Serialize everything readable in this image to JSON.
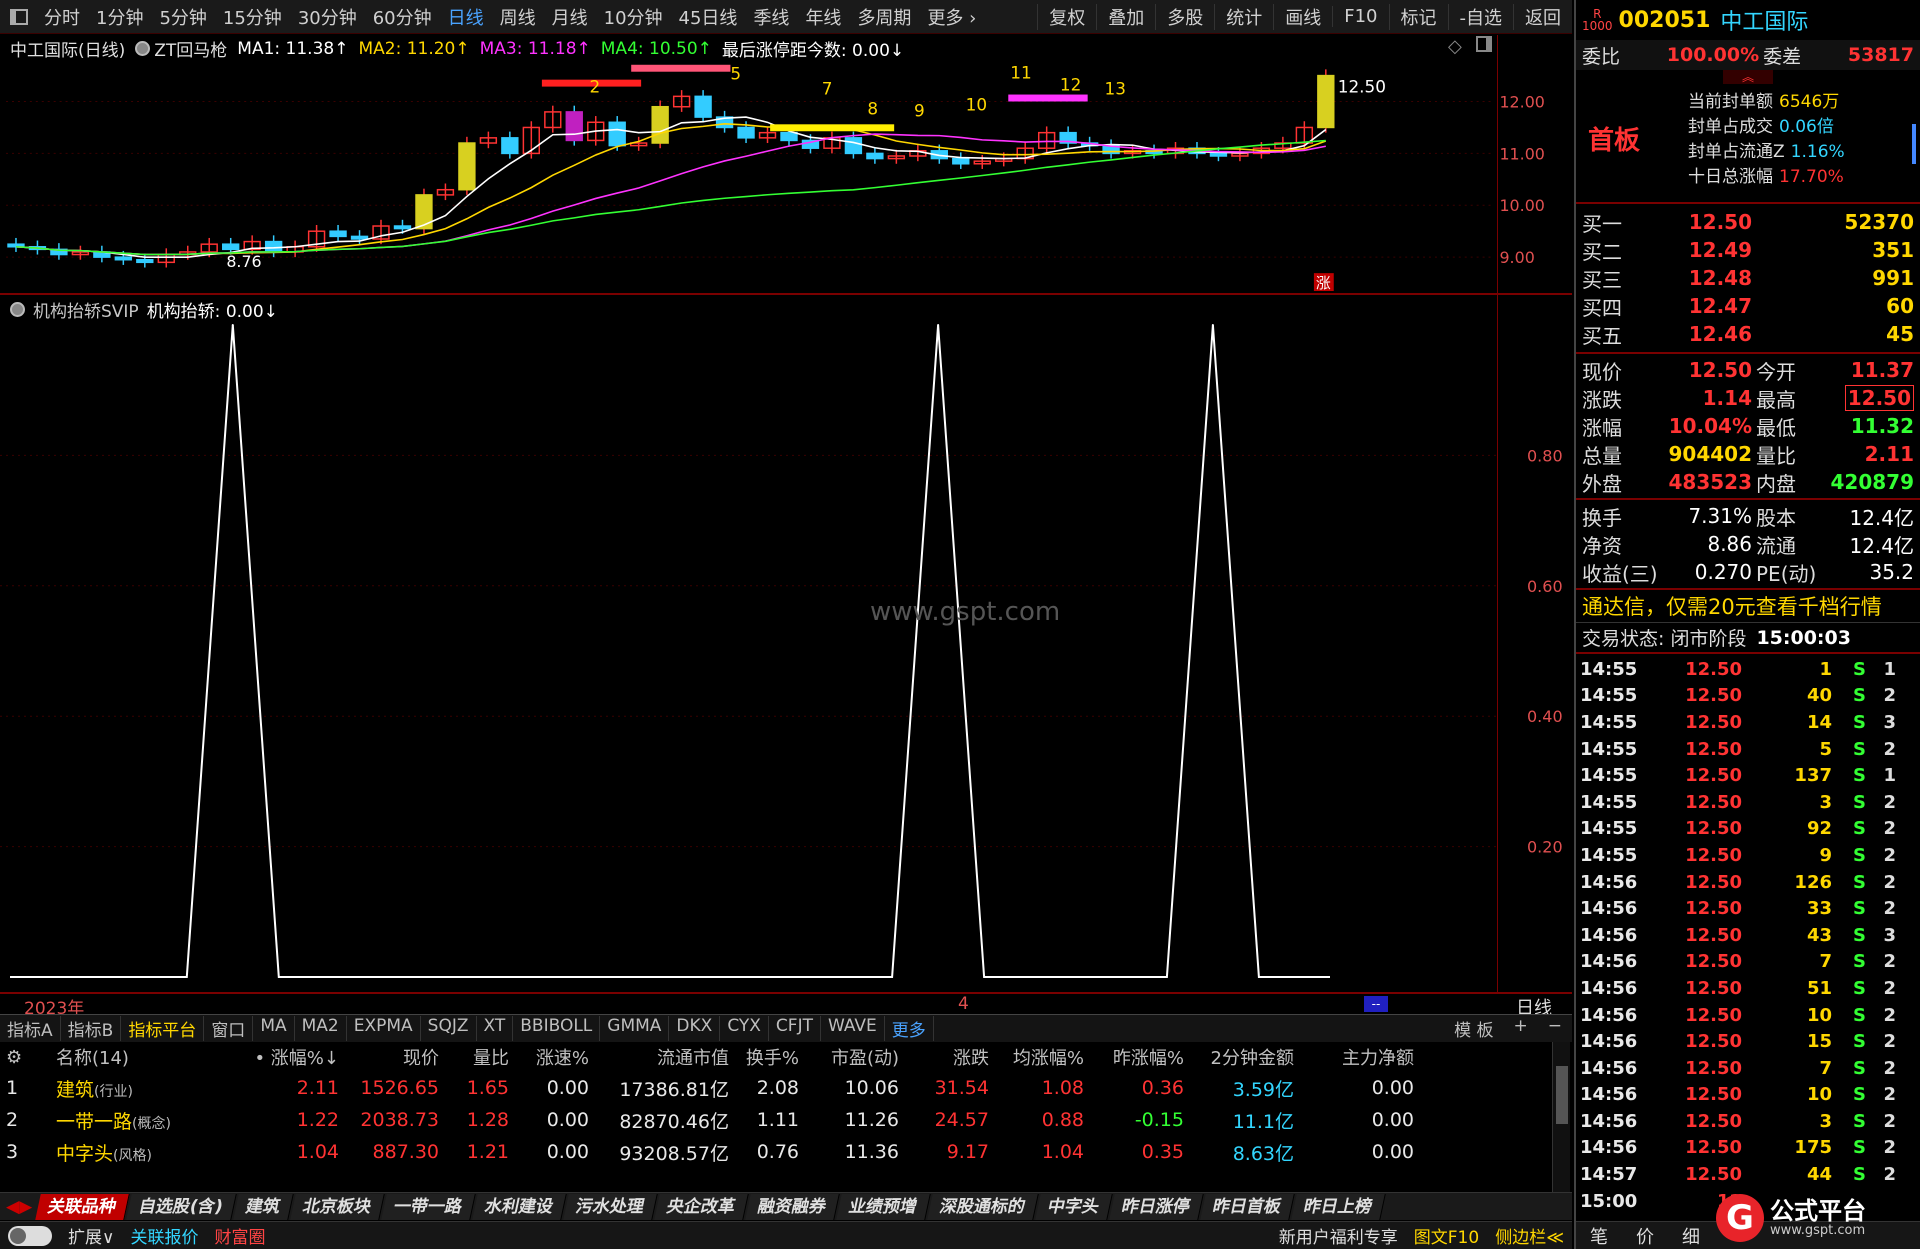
{
  "toolbar": {
    "left": [
      "分时",
      "1分钟",
      "5分钟",
      "15分钟",
      "30分钟",
      "60分钟",
      "日线",
      "周线",
      "月线",
      "10分钟",
      "45日线",
      "季线",
      "年线",
      "多周期",
      "更多 ›"
    ],
    "active": "日线",
    "right": [
      "复权",
      "叠加",
      "多股",
      "统计",
      "画线",
      "F10",
      "标记",
      "-自选",
      "返回"
    ]
  },
  "kline": {
    "title": "中工国际(日线)",
    "indicator": "ZT回马枪",
    "ma1": "MA1: 11.38↑",
    "ma2": "MA2: 11.20↑",
    "ma3": "MA3: 11.18↑",
    "ma4": "MA4: 10.50↑",
    "extra": "最后涨停距今数: 0.00↓",
    "y_ticks": [
      "12.00",
      "11.00",
      "10.00",
      "9.00"
    ],
    "high_label": "12.50",
    "low_label": "8.76",
    "marker": "涨",
    "numbers": [
      "2",
      "5",
      "7",
      "8",
      "9",
      "10",
      "11",
      "12",
      "13"
    ]
  },
  "indicator": {
    "name": "机构抬轿SVIP",
    "value": "机构抬轿: 0.00↓",
    "y_ticks": [
      "0.80",
      "0.60",
      "0.40",
      "0.20"
    ],
    "watermark": "www.gspt.com",
    "peaks_x_fraction": [
      0.15,
      0.625,
      0.81
    ],
    "peak_value": 1.0,
    "year_label": "2023年",
    "month_label": "4",
    "period_label": "日线"
  },
  "tabs": {
    "items": [
      "指标A",
      "指标B",
      "指标平台",
      "窗口",
      "MA",
      "MA2",
      "EXPMA",
      "SQJZ",
      "XT",
      "BBIBOLL",
      "GMMA",
      "DKX",
      "CYX",
      "CFJT",
      "WAVE",
      "更多"
    ],
    "active": "指标平台",
    "right": [
      "模 板",
      "+",
      "−"
    ]
  },
  "table": {
    "headers": [
      "",
      "名称(14)",
      "• 涨幅%↓",
      "现价",
      "量比",
      "涨速%",
      "流通市值",
      "换手%",
      "市盈(动)",
      "涨跌",
      "均涨幅%",
      "昨涨幅%",
      "2分钟金额",
      "主力净额"
    ],
    "rows": [
      {
        "idx": "1",
        "name": "建筑",
        "tag": "(行业)",
        "chg": "2.11",
        "price": "1526.65",
        "vr": "1.65",
        "speed": "0.00",
        "mcap": "17386.81亿",
        "turn": "2.08",
        "pe": "10.06",
        "diff": "31.54",
        "avg": "1.08",
        "prev": "0.36",
        "amt2": "3.59亿",
        "net": "0.00"
      },
      {
        "idx": "2",
        "name": "一带一路",
        "tag": "(概念)",
        "chg": "1.22",
        "price": "2038.73",
        "vr": "1.28",
        "speed": "0.00",
        "mcap": "82870.46亿",
        "turn": "1.11",
        "pe": "11.26",
        "diff": "24.57",
        "avg": "0.88",
        "prev": "-0.15",
        "amt2": "11.1亿",
        "net": "0.00"
      },
      {
        "idx": "3",
        "name": "中字头",
        "tag": "(风格)",
        "chg": "1.04",
        "price": "887.30",
        "vr": "1.21",
        "speed": "0.00",
        "mcap": "93208.57亿",
        "turn": "0.76",
        "pe": "11.36",
        "diff": "9.17",
        "avg": "1.04",
        "prev": "0.35",
        "amt2": "8.63亿",
        "net": "0.00"
      }
    ]
  },
  "bottom_tabs": [
    "关联品种",
    "自选股(含)",
    "建筑",
    "北京板块",
    "一带一路",
    "水利建设",
    "污水处理",
    "央企改革",
    "融资融券",
    "业绩预增",
    "深股通标的",
    "中字头",
    "昨日涨停",
    "昨日首板",
    "昨日上榜"
  ],
  "status": {
    "items": [
      "扩展∨",
      "关联报价",
      "财富圈"
    ],
    "right": [
      "新用户福利专享",
      "图文F10",
      "侧边栏≪"
    ]
  },
  "right_panel": {
    "code": "002051",
    "name": "中工国际",
    "weibi_label": "委比",
    "weibi": "100.00%",
    "weicha_label": "委差",
    "weicha": "53817",
    "first_board": "首板",
    "seal": [
      {
        "label": "当前封单额",
        "value": "6546万"
      },
      {
        "label": "封单占成交",
        "value": "0.06倍"
      },
      {
        "label": "封单占流通Z",
        "value": "1.16%"
      },
      {
        "label": "十日总涨幅",
        "value": "17.70%"
      }
    ],
    "bids": [
      {
        "label": "买一",
        "price": "12.50",
        "vol": "52370"
      },
      {
        "label": "买二",
        "price": "12.49",
        "vol": "351"
      },
      {
        "label": "买三",
        "price": "12.48",
        "vol": "991"
      },
      {
        "label": "买四",
        "price": "12.47",
        "vol": "60"
      },
      {
        "label": "买五",
        "price": "12.46",
        "vol": "45"
      }
    ],
    "quote": [
      {
        "l1": "现价",
        "v1": "12.50",
        "c1": "red",
        "l2": "今开",
        "v2": "11.37",
        "c2": "red"
      },
      {
        "l1": "涨跌",
        "v1": "1.14",
        "c1": "red",
        "l2": "最高",
        "v2": "12.50",
        "c2": "red"
      },
      {
        "l1": "涨幅",
        "v1": "10.04%",
        "c1": "red",
        "l2": "最低",
        "v2": "11.32",
        "c2": "green"
      },
      {
        "l1": "总量",
        "v1": "904402",
        "c1": "yellow",
        "l2": "量比",
        "v2": "2.11",
        "c2": "red"
      },
      {
        "l1": "外盘",
        "v1": "483523",
        "c1": "red",
        "l2": "内盘",
        "v2": "420879",
        "c2": "green"
      }
    ],
    "fund": [
      {
        "l1": "换手",
        "v1": "7.31%",
        "l2": "股本",
        "v2": "12.4亿"
      },
      {
        "l1": "净资",
        "v1": "8.86",
        "l2": "流通",
        "v2": "12.4亿"
      },
      {
        "l1": "收益(三)",
        "v1": "0.270",
        "l2": "PE(动)",
        "v2": "35.2"
      }
    ],
    "promo": "通达信，仅需20元查看千档行情",
    "trade_state": "交易状态: 闭市阶段",
    "trade_time": "15:00:03",
    "ticks": [
      {
        "t": "14:55",
        "p": "12.50",
        "v": "1",
        "s": "S",
        "n": "1"
      },
      {
        "t": "14:55",
        "p": "12.50",
        "v": "40",
        "s": "S",
        "n": "2"
      },
      {
        "t": "14:55",
        "p": "12.50",
        "v": "14",
        "s": "S",
        "n": "3"
      },
      {
        "t": "14:55",
        "p": "12.50",
        "v": "5",
        "s": "S",
        "n": "2"
      },
      {
        "t": "14:55",
        "p": "12.50",
        "v": "137",
        "s": "S",
        "n": "1"
      },
      {
        "t": "14:55",
        "p": "12.50",
        "v": "3",
        "s": "S",
        "n": "2"
      },
      {
        "t": "14:55",
        "p": "12.50",
        "v": "92",
        "s": "S",
        "n": "2"
      },
      {
        "t": "14:55",
        "p": "12.50",
        "v": "9",
        "s": "S",
        "n": "2"
      },
      {
        "t": "14:56",
        "p": "12.50",
        "v": "126",
        "s": "S",
        "n": "2"
      },
      {
        "t": "14:56",
        "p": "12.50",
        "v": "33",
        "s": "S",
        "n": "2"
      },
      {
        "t": "14:56",
        "p": "12.50",
        "v": "43",
        "s": "S",
        "n": "3"
      },
      {
        "t": "14:56",
        "p": "12.50",
        "v": "7",
        "s": "S",
        "n": "2"
      },
      {
        "t": "14:56",
        "p": "12.50",
        "v": "51",
        "s": "S",
        "n": "2"
      },
      {
        "t": "14:56",
        "p": "12.50",
        "v": "10",
        "s": "S",
        "n": "2"
      },
      {
        "t": "14:56",
        "p": "12.50",
        "v": "15",
        "s": "S",
        "n": "2"
      },
      {
        "t": "14:56",
        "p": "12.50",
        "v": "7",
        "s": "S",
        "n": "2"
      },
      {
        "t": "14:56",
        "p": "12.50",
        "v": "10",
        "s": "S",
        "n": "2"
      },
      {
        "t": "14:56",
        "p": "12.50",
        "v": "3",
        "s": "S",
        "n": "2"
      },
      {
        "t": "14:56",
        "p": "12.50",
        "v": "175",
        "s": "S",
        "n": "2"
      },
      {
        "t": "14:57",
        "p": "12.50",
        "v": "44",
        "s": "S",
        "n": "2"
      },
      {
        "t": "15:00",
        "p": "12",
        "v": "",
        "s": "",
        "n": ""
      }
    ],
    "bottom": [
      "笔",
      "价",
      "细"
    ],
    "logo": "公式平台",
    "logo_url_text": "www.gspt.com"
  }
}
